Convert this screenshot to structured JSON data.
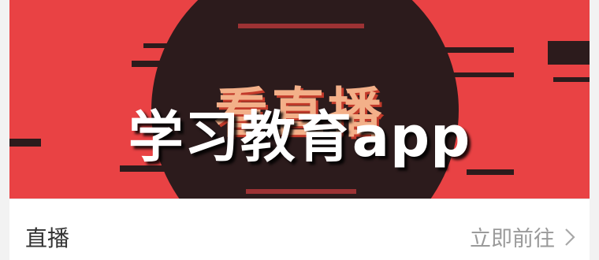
{
  "banner": {
    "background_text": "看直播",
    "overlay_title": "学习教育app",
    "colors": {
      "background": "#e94244",
      "circle": "#2c1b1c",
      "text": "#f3b089"
    }
  },
  "footer": {
    "label": "直播",
    "link_label": "立即前往",
    "link_icon": "chevron-right-icon"
  }
}
